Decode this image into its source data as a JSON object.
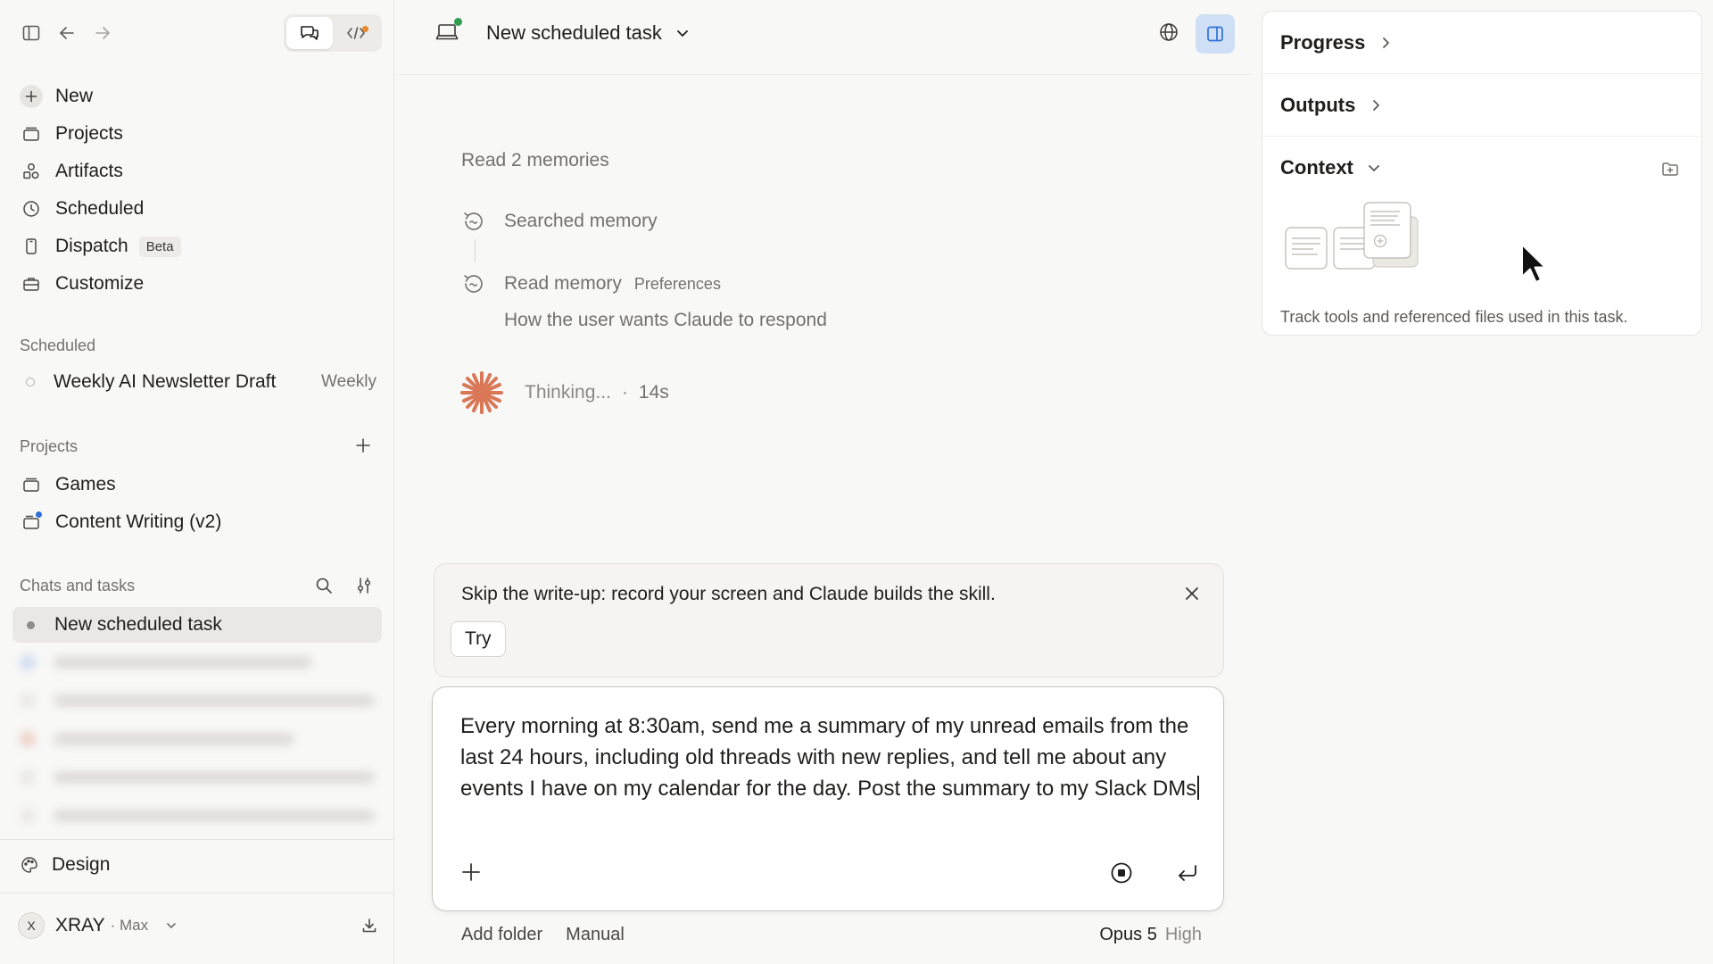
{
  "sidebar": {
    "nav": [
      {
        "label": "New",
        "icon": "plus-icon"
      },
      {
        "label": "Projects",
        "icon": "folder-icon"
      },
      {
        "label": "Artifacts",
        "icon": "shapes-icon"
      },
      {
        "label": "Scheduled",
        "icon": "clock-icon"
      },
      {
        "label": "Dispatch",
        "icon": "phone-icon",
        "badge": "Beta"
      },
      {
        "label": "Customize",
        "icon": "briefcase-icon"
      }
    ],
    "scheduled_header": "Scheduled",
    "scheduled_items": [
      {
        "label": "Weekly AI Newsletter Draft",
        "frequency": "Weekly"
      }
    ],
    "projects_header": "Projects",
    "projects": [
      {
        "label": "Games"
      },
      {
        "label": "Content Writing (v2)"
      }
    ],
    "chats_header": "Chats and tasks",
    "active_task": "New scheduled task",
    "design_label": "Design",
    "account": {
      "initial": "X",
      "name": "XRAY",
      "plan": "· Max"
    }
  },
  "header": {
    "title": "New scheduled task"
  },
  "conversation": {
    "memories_header": "Read 2 memories",
    "searched": "Searched memory",
    "read": "Read memory",
    "read_tag": "Preferences",
    "read_desc": "How the user wants Claude to respond",
    "thinking": "Thinking...",
    "thinking_sep": "·",
    "thinking_time": "14s"
  },
  "tip": {
    "text": "Skip the write-up: record your screen and Claude builds the skill.",
    "try_label": "Try"
  },
  "composer": {
    "text": "Every morning at 8:30am, send me a summary of my unread emails from the last 24 hours, including old threads with new replies, and tell me about any events I have on my calendar for the day. Post the summary to my Slack DMs"
  },
  "footer": {
    "add_folder": "Add folder",
    "mode": "Manual",
    "model": "Opus 5",
    "effort": "High"
  },
  "panel": {
    "progress": "Progress",
    "outputs": "Outputs",
    "context": "Context",
    "context_desc": "Track tools and referenced files used in this task."
  },
  "colors": {
    "accent_blue": "#2f6fd6",
    "status_green": "#2f9e4f",
    "spark_orange": "#d97757",
    "notify_orange": "#e8892f"
  }
}
